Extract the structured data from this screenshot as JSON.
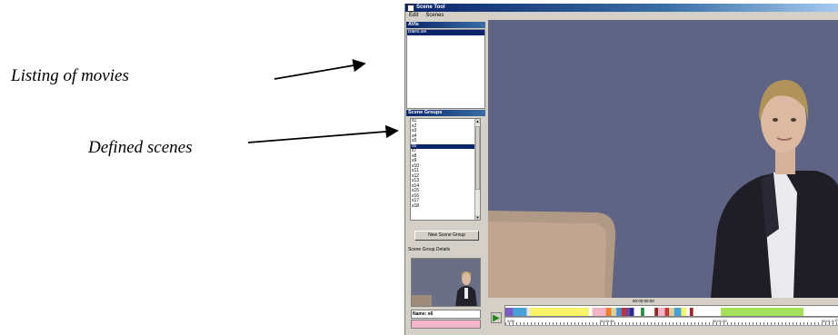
{
  "annotations": {
    "movies": "Listing of movies",
    "scenes": "Defined scenes"
  },
  "app": {
    "title": "Scene Tool",
    "menu": [
      "Edit",
      "Scenes"
    ],
    "avis_header": "AVIs",
    "avis": [
      "Bales.avi"
    ],
    "scene_groups_header": "Scene Groups",
    "scene_groups": [
      "s1",
      "s2",
      "s3",
      "s4",
      "s5",
      "s6",
      "s7",
      "s8",
      "s9",
      "s10",
      "s11",
      "s12",
      "s13",
      "s14",
      "s15",
      "s16",
      "s17",
      "s18"
    ],
    "selected_scene": "s6",
    "new_scene_group_button": "New Scene Group",
    "details_label": "Scene Group Details",
    "name_label": "Name: s6",
    "timecode": "00:00:00:00",
    "ruler_labels": [
      "0:00",
      "00:00:30",
      "00:01:00",
      "00:01:3"
    ]
  },
  "timeline_segments": [
    {
      "color": "#7b5cc4",
      "w": 2.2
    },
    {
      "color": "#4aa0d8",
      "w": 4
    },
    {
      "color": "#e8e6e0",
      "w": 1
    },
    {
      "color": "#f7f46a",
      "w": 17
    },
    {
      "color": "#ffffff",
      "w": 1
    },
    {
      "color": "#f3b5c6",
      "w": 4
    },
    {
      "color": "#f07a2a",
      "w": 1.5
    },
    {
      "color": "#d6d39a",
      "w": 1.5
    },
    {
      "color": "#4a90d9",
      "w": 1.5
    },
    {
      "color": "#c8322a",
      "w": 1.2
    },
    {
      "color": "#6a4aa0",
      "w": 1.2
    },
    {
      "color": "#2a2a90",
      "w": 1.2
    },
    {
      "color": "#ffffff",
      "w": 2
    },
    {
      "color": "#2a8a4a",
      "w": 1
    },
    {
      "color": "#ffffff",
      "w": 3
    },
    {
      "color": "#8a2a2a",
      "w": 1
    },
    {
      "color": "#f3b5c6",
      "w": 2
    },
    {
      "color": "#c03a3a",
      "w": 1.2
    },
    {
      "color": "#d6d39a",
      "w": 1.5
    },
    {
      "color": "#4aa0d8",
      "w": 2
    },
    {
      "color": "#f7f46a",
      "w": 1.5
    },
    {
      "color": "#ffffff",
      "w": 1
    },
    {
      "color": "#9b2a2a",
      "w": 1
    },
    {
      "color": "#ffffff",
      "w": 8
    },
    {
      "color": "#a6e05a",
      "w": 24
    },
    {
      "color": "#ffffff",
      "w": 10
    }
  ]
}
